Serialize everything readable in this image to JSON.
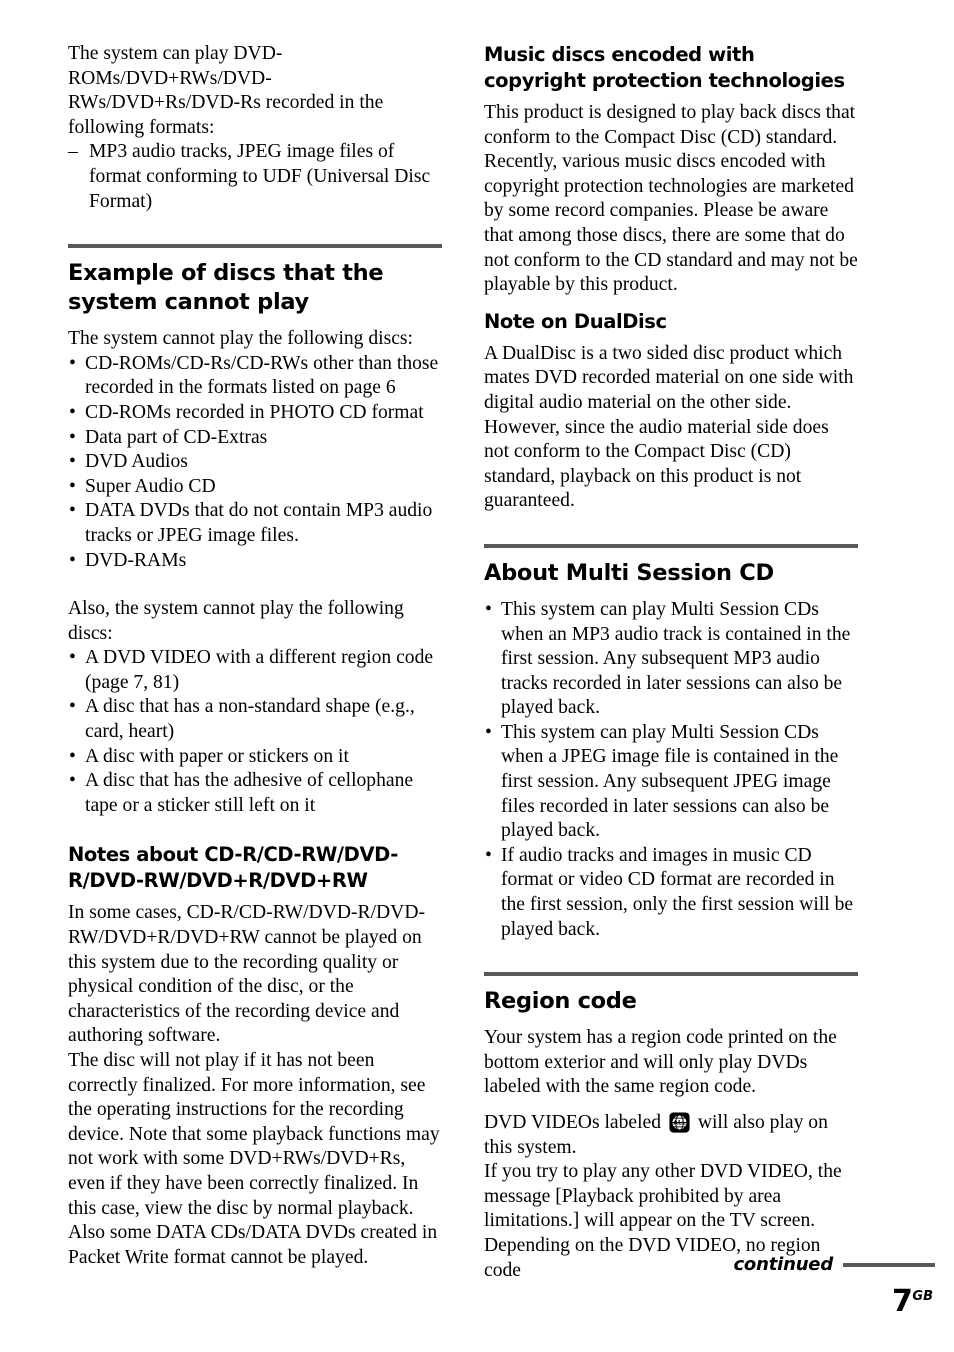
{
  "page": {
    "number": "7",
    "region_suffix": "GB",
    "continued_label": "continued"
  },
  "colors": {
    "rule": "#595959",
    "text": "#000000",
    "background": "#ffffff"
  },
  "left_column": {
    "intro": {
      "paragraph": "The system can play DVD-ROMs/DVD+RWs/DVD-RWs/DVD+Rs/DVD-Rs recorded in the following formats:",
      "dash_items": [
        "MP3 audio tracks, JPEG image files of format conforming to UDF (Universal Disc Format)"
      ]
    },
    "section_cannot_play": {
      "heading": "Example of discs that the system cannot play",
      "lead": "The system cannot play the following discs:",
      "bullets": [
        "CD-ROMs/CD-Rs/CD-RWs other than those recorded in the formats listed on page 6",
        "CD-ROMs recorded in PHOTO CD format",
        "Data part of CD-Extras",
        "DVD Audios",
        "Super Audio CD",
        "DATA DVDs that do not contain MP3 audio tracks or JPEG image files.",
        "DVD-RAMs"
      ],
      "lead2": "Also, the system cannot play the following discs:",
      "bullets2": [
        "A DVD VIDEO with a different region code (page 7, 81)",
        "A disc that has a non-standard shape (e.g., card, heart)",
        "A disc with paper or stickers on it",
        "A disc that has the adhesive of cellophane tape or a sticker still left on it"
      ]
    },
    "subsection_notes": {
      "heading": "Notes about CD-R/CD-RW/DVD-R/DVD-RW/DVD+R/DVD+RW",
      "paragraph1": "In some cases, CD-R/CD-RW/DVD-R/DVD-RW/DVD+R/DVD+RW cannot be played on this system due to the recording quality or physical condition of the disc, or the characteristics of the recording device and authoring software.",
      "paragraph2": "The disc will not play if it has not been correctly finalized. For more information, see the operating instructions for the recording device. Note that some playback functions may not work with some DVD+RWs/DVD+Rs, even if they have been correctly finalized. In this case, view the disc by normal playback. Also some DATA CDs/DATA DVDs created in Packet Write format cannot be played."
    }
  },
  "right_column": {
    "subsection_copyright": {
      "heading": "Music discs encoded with copyright protection technologies",
      "paragraph": "This product is designed to play back discs that conform to the Compact Disc (CD) standard. Recently, various music discs encoded with copyright protection technologies are marketed by some record companies. Please be aware that among those discs, there are some that do not conform to the CD standard and may not be playable by this product."
    },
    "subsection_dualdisc": {
      "heading": "Note on DualDisc",
      "paragraph": "A DualDisc is a two sided disc product which mates DVD recorded material on one side with digital audio material on the other side. However, since the audio material side does not conform to the Compact Disc (CD) standard, playback on this product is not guaranteed."
    },
    "section_multisession": {
      "heading": "About Multi Session CD",
      "bullets": [
        "This system can play Multi Session CDs when an MP3 audio track is contained in the first session. Any subsequent MP3 audio tracks recorded in later sessions can also be played back.",
        "This system can play Multi Session CDs when a JPEG image file is contained in the first session. Any subsequent JPEG image files recorded in later sessions can also be played back.",
        "If audio tracks and images in music CD format or video CD format are recorded in the first session, only the first session will be played back."
      ]
    },
    "section_region": {
      "heading": "Region code",
      "paragraph1": "Your system has a region code printed on the bottom exterior and will only play DVDs labeled with the same region code.",
      "labeled_prefix": "DVD VIDEOs labeled",
      "icon_label": "ALL",
      "labeled_suffix": "will also play on this system.",
      "paragraph2": "If you try to play any other DVD VIDEO, the message [Playback prohibited by area limitations.] will appear on the TV screen. Depending on the DVD VIDEO, no region code"
    }
  }
}
